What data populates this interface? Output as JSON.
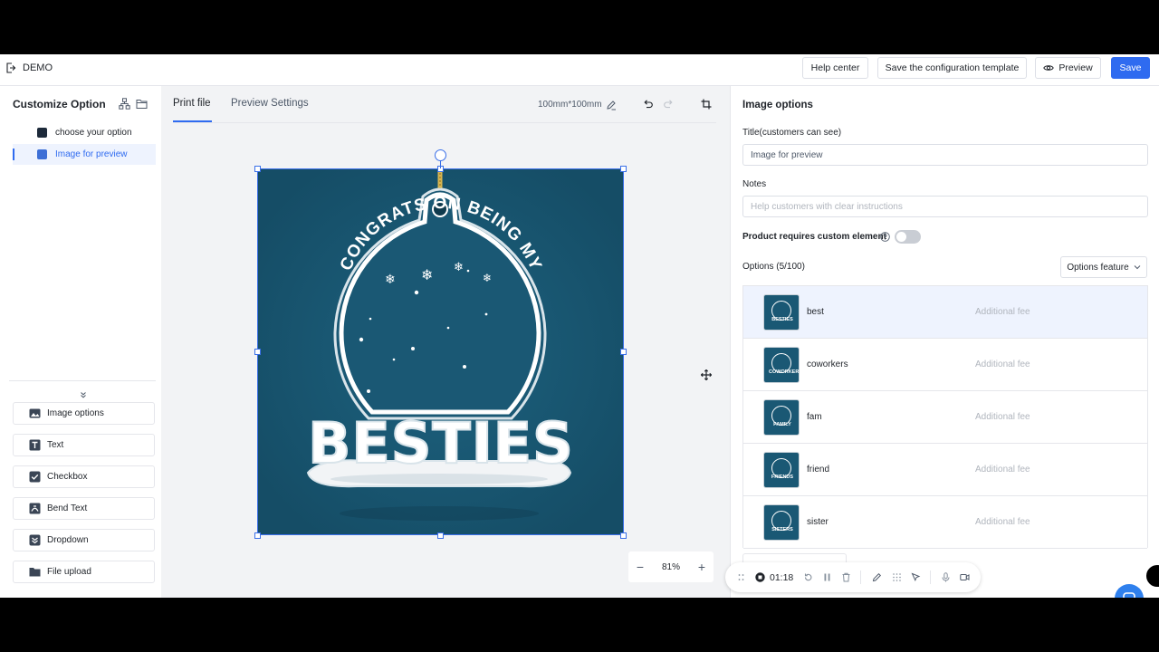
{
  "app": {
    "title": "DEMO"
  },
  "topbar": {
    "help_label": "Help center",
    "save_template_label": "Save the configuration template",
    "preview_label": "Preview",
    "save_label": "Save"
  },
  "left": {
    "title": "Customize Option",
    "options": [
      {
        "label": "choose your option"
      },
      {
        "label": "Image for preview"
      }
    ],
    "components": [
      {
        "label": "Image options",
        "icon": "image-icon"
      },
      {
        "label": "Text",
        "icon": "text-icon"
      },
      {
        "label": "Checkbox",
        "icon": "checkbox-icon"
      },
      {
        "label": "Bend Text",
        "icon": "bend-text-icon"
      },
      {
        "label": "Dropdown",
        "icon": "dropdown-icon"
      },
      {
        "label": "File upload",
        "icon": "folder-icon"
      }
    ]
  },
  "center": {
    "tabs": [
      {
        "label": "Print file"
      },
      {
        "label": "Preview Settings"
      }
    ],
    "dimension": "100mm*100mm",
    "zoom": "81%",
    "artwork": {
      "arc_text": "CONGRATS ON BEING MY",
      "main_text": "BESTIES",
      "background_color": "#1a5874"
    }
  },
  "right": {
    "title": "Image options",
    "title_label": "Title(customers can see)",
    "title_value": "Image for preview",
    "notes_label": "Notes",
    "notes_placeholder": "Help customers with clear instructions",
    "custom_element_label": "Product requires custom element",
    "options_label": "Options (5/100)",
    "options_feature_label": "Options feature",
    "options": [
      {
        "name": "best",
        "fee": "Additional fee",
        "thumb": "BESTIES"
      },
      {
        "name": "coworkers",
        "fee": "Additional fee",
        "thumb": "COWORKERS"
      },
      {
        "name": "fam",
        "fee": "Additional fee",
        "thumb": "FAMILY"
      },
      {
        "name": "friend",
        "fee": "Additional fee",
        "thumb": "FRIENDS"
      },
      {
        "name": "sister",
        "fee": "Additional fee",
        "thumb": "SISTERS"
      }
    ]
  },
  "recorder": {
    "time": "01:18"
  },
  "colors": {
    "accent": "#2f6bf0",
    "canvas": "#1a5874"
  }
}
